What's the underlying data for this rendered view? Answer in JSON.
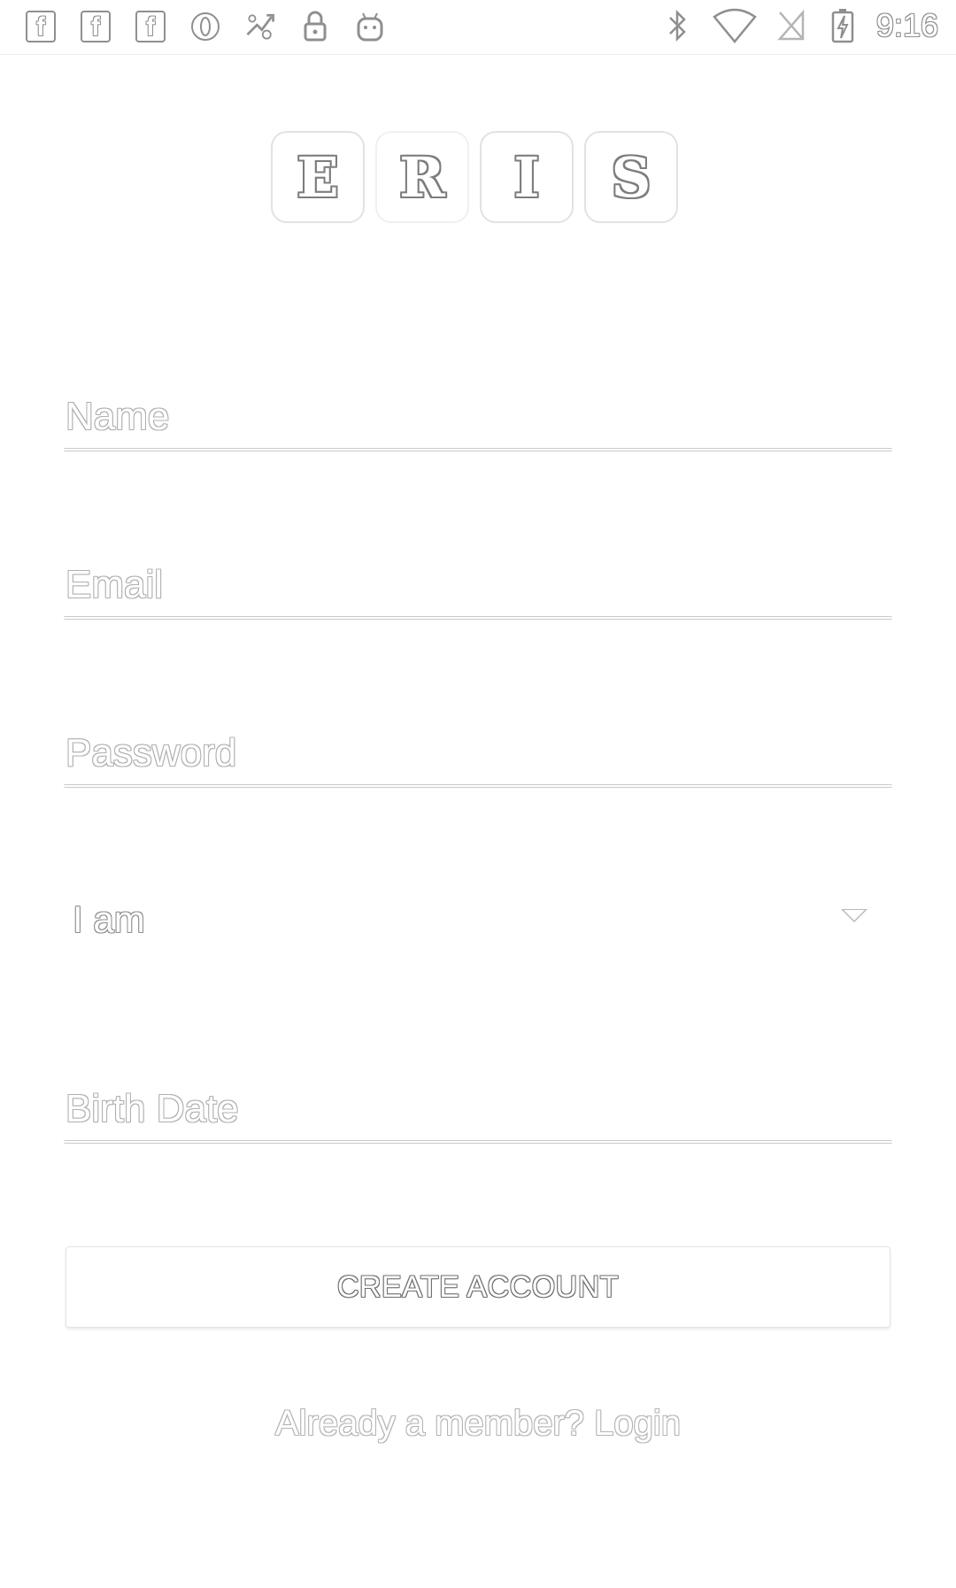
{
  "status_bar": {
    "left_icons": [
      "facebook-icon",
      "facebook-icon",
      "facebook-icon",
      "opera-icon",
      "sync-icon",
      "lock-icon",
      "android-icon"
    ],
    "right_icons": [
      "bluetooth-icon",
      "wifi-icon",
      "no-sim-icon",
      "battery-charging-icon"
    ],
    "time": "9:16",
    "fb_glyph": "f"
  },
  "logo": {
    "letters": [
      "E",
      "R",
      "I",
      "S"
    ]
  },
  "form": {
    "name_placeholder": "Name",
    "email_placeholder": "Email",
    "password_placeholder": "Password",
    "gender_select_value": "I am",
    "birthdate_placeholder": "Birth Date"
  },
  "actions": {
    "create_account_label": "CREATE ACCOUNT",
    "login_link_label": "Already a member? Login"
  },
  "colors": {
    "background": "#ffffff",
    "outline": "#8f8f8f",
    "underline": "#c9c9c9"
  }
}
